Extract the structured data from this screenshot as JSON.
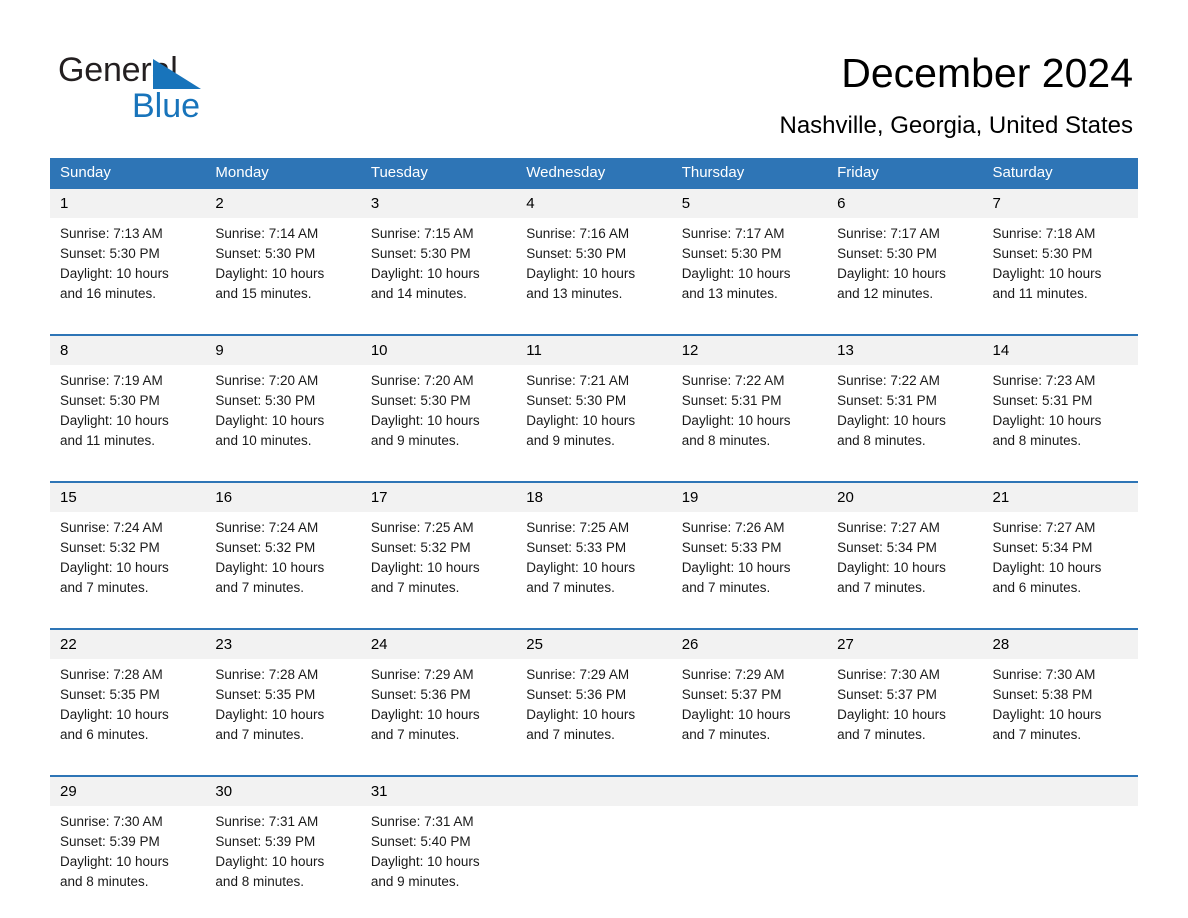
{
  "brand": {
    "name_part1": "General",
    "name_part2": "Blue",
    "triangle_color": "#1874bb"
  },
  "header": {
    "month_title": "December 2024",
    "location": "Nashville, Georgia, United States"
  },
  "theme": {
    "header_blue": "#2e75b6",
    "daynum_background": "#f2f2f2",
    "text_color": "#000000"
  },
  "calendar": {
    "weekday_headers": [
      "Sunday",
      "Monday",
      "Tuesday",
      "Wednesday",
      "Thursday",
      "Friday",
      "Saturday"
    ],
    "weeks": [
      {
        "days": [
          {
            "date": "1",
            "sunrise": "Sunrise: 7:13 AM",
            "sunset": "Sunset: 5:30 PM",
            "daylight_line1": "Daylight: 10 hours",
            "daylight_line2": "and 16 minutes."
          },
          {
            "date": "2",
            "sunrise": "Sunrise: 7:14 AM",
            "sunset": "Sunset: 5:30 PM",
            "daylight_line1": "Daylight: 10 hours",
            "daylight_line2": "and 15 minutes."
          },
          {
            "date": "3",
            "sunrise": "Sunrise: 7:15 AM",
            "sunset": "Sunset: 5:30 PM",
            "daylight_line1": "Daylight: 10 hours",
            "daylight_line2": "and 14 minutes."
          },
          {
            "date": "4",
            "sunrise": "Sunrise: 7:16 AM",
            "sunset": "Sunset: 5:30 PM",
            "daylight_line1": "Daylight: 10 hours",
            "daylight_line2": "and 13 minutes."
          },
          {
            "date": "5",
            "sunrise": "Sunrise: 7:17 AM",
            "sunset": "Sunset: 5:30 PM",
            "daylight_line1": "Daylight: 10 hours",
            "daylight_line2": "and 13 minutes."
          },
          {
            "date": "6",
            "sunrise": "Sunrise: 7:17 AM",
            "sunset": "Sunset: 5:30 PM",
            "daylight_line1": "Daylight: 10 hours",
            "daylight_line2": "and 12 minutes."
          },
          {
            "date": "7",
            "sunrise": "Sunrise: 7:18 AM",
            "sunset": "Sunset: 5:30 PM",
            "daylight_line1": "Daylight: 10 hours",
            "daylight_line2": "and 11 minutes."
          }
        ]
      },
      {
        "days": [
          {
            "date": "8",
            "sunrise": "Sunrise: 7:19 AM",
            "sunset": "Sunset: 5:30 PM",
            "daylight_line1": "Daylight: 10 hours",
            "daylight_line2": "and 11 minutes."
          },
          {
            "date": "9",
            "sunrise": "Sunrise: 7:20 AM",
            "sunset": "Sunset: 5:30 PM",
            "daylight_line1": "Daylight: 10 hours",
            "daylight_line2": "and 10 minutes."
          },
          {
            "date": "10",
            "sunrise": "Sunrise: 7:20 AM",
            "sunset": "Sunset: 5:30 PM",
            "daylight_line1": "Daylight: 10 hours",
            "daylight_line2": "and 9 minutes."
          },
          {
            "date": "11",
            "sunrise": "Sunrise: 7:21 AM",
            "sunset": "Sunset: 5:30 PM",
            "daylight_line1": "Daylight: 10 hours",
            "daylight_line2": "and 9 minutes."
          },
          {
            "date": "12",
            "sunrise": "Sunrise: 7:22 AM",
            "sunset": "Sunset: 5:31 PM",
            "daylight_line1": "Daylight: 10 hours",
            "daylight_line2": "and 8 minutes."
          },
          {
            "date": "13",
            "sunrise": "Sunrise: 7:22 AM",
            "sunset": "Sunset: 5:31 PM",
            "daylight_line1": "Daylight: 10 hours",
            "daylight_line2": "and 8 minutes."
          },
          {
            "date": "14",
            "sunrise": "Sunrise: 7:23 AM",
            "sunset": "Sunset: 5:31 PM",
            "daylight_line1": "Daylight: 10 hours",
            "daylight_line2": "and 8 minutes."
          }
        ]
      },
      {
        "days": [
          {
            "date": "15",
            "sunrise": "Sunrise: 7:24 AM",
            "sunset": "Sunset: 5:32 PM",
            "daylight_line1": "Daylight: 10 hours",
            "daylight_line2": "and 7 minutes."
          },
          {
            "date": "16",
            "sunrise": "Sunrise: 7:24 AM",
            "sunset": "Sunset: 5:32 PM",
            "daylight_line1": "Daylight: 10 hours",
            "daylight_line2": "and 7 minutes."
          },
          {
            "date": "17",
            "sunrise": "Sunrise: 7:25 AM",
            "sunset": "Sunset: 5:32 PM",
            "daylight_line1": "Daylight: 10 hours",
            "daylight_line2": "and 7 minutes."
          },
          {
            "date": "18",
            "sunrise": "Sunrise: 7:25 AM",
            "sunset": "Sunset: 5:33 PM",
            "daylight_line1": "Daylight: 10 hours",
            "daylight_line2": "and 7 minutes."
          },
          {
            "date": "19",
            "sunrise": "Sunrise: 7:26 AM",
            "sunset": "Sunset: 5:33 PM",
            "daylight_line1": "Daylight: 10 hours",
            "daylight_line2": "and 7 minutes."
          },
          {
            "date": "20",
            "sunrise": "Sunrise: 7:27 AM",
            "sunset": "Sunset: 5:34 PM",
            "daylight_line1": "Daylight: 10 hours",
            "daylight_line2": "and 7 minutes."
          },
          {
            "date": "21",
            "sunrise": "Sunrise: 7:27 AM",
            "sunset": "Sunset: 5:34 PM",
            "daylight_line1": "Daylight: 10 hours",
            "daylight_line2": "and 6 minutes."
          }
        ]
      },
      {
        "days": [
          {
            "date": "22",
            "sunrise": "Sunrise: 7:28 AM",
            "sunset": "Sunset: 5:35 PM",
            "daylight_line1": "Daylight: 10 hours",
            "daylight_line2": "and 6 minutes."
          },
          {
            "date": "23",
            "sunrise": "Sunrise: 7:28 AM",
            "sunset": "Sunset: 5:35 PM",
            "daylight_line1": "Daylight: 10 hours",
            "daylight_line2": "and 7 minutes."
          },
          {
            "date": "24",
            "sunrise": "Sunrise: 7:29 AM",
            "sunset": "Sunset: 5:36 PM",
            "daylight_line1": "Daylight: 10 hours",
            "daylight_line2": "and 7 minutes."
          },
          {
            "date": "25",
            "sunrise": "Sunrise: 7:29 AM",
            "sunset": "Sunset: 5:36 PM",
            "daylight_line1": "Daylight: 10 hours",
            "daylight_line2": "and 7 minutes."
          },
          {
            "date": "26",
            "sunrise": "Sunrise: 7:29 AM",
            "sunset": "Sunset: 5:37 PM",
            "daylight_line1": "Daylight: 10 hours",
            "daylight_line2": "and 7 minutes."
          },
          {
            "date": "27",
            "sunrise": "Sunrise: 7:30 AM",
            "sunset": "Sunset: 5:37 PM",
            "daylight_line1": "Daylight: 10 hours",
            "daylight_line2": "and 7 minutes."
          },
          {
            "date": "28",
            "sunrise": "Sunrise: 7:30 AM",
            "sunset": "Sunset: 5:38 PM",
            "daylight_line1": "Daylight: 10 hours",
            "daylight_line2": "and 7 minutes."
          }
        ]
      },
      {
        "days": [
          {
            "date": "29",
            "sunrise": "Sunrise: 7:30 AM",
            "sunset": "Sunset: 5:39 PM",
            "daylight_line1": "Daylight: 10 hours",
            "daylight_line2": "and 8 minutes."
          },
          {
            "date": "30",
            "sunrise": "Sunrise: 7:31 AM",
            "sunset": "Sunset: 5:39 PM",
            "daylight_line1": "Daylight: 10 hours",
            "daylight_line2": "and 8 minutes."
          },
          {
            "date": "31",
            "sunrise": "Sunrise: 7:31 AM",
            "sunset": "Sunset: 5:40 PM",
            "daylight_line1": "Daylight: 10 hours",
            "daylight_line2": "and 9 minutes."
          },
          {
            "date": "",
            "sunrise": "",
            "sunset": "",
            "daylight_line1": "",
            "daylight_line2": ""
          },
          {
            "date": "",
            "sunrise": "",
            "sunset": "",
            "daylight_line1": "",
            "daylight_line2": ""
          },
          {
            "date": "",
            "sunrise": "",
            "sunset": "",
            "daylight_line1": "",
            "daylight_line2": ""
          },
          {
            "date": "",
            "sunrise": "",
            "sunset": "",
            "daylight_line1": "",
            "daylight_line2": ""
          }
        ]
      }
    ]
  }
}
